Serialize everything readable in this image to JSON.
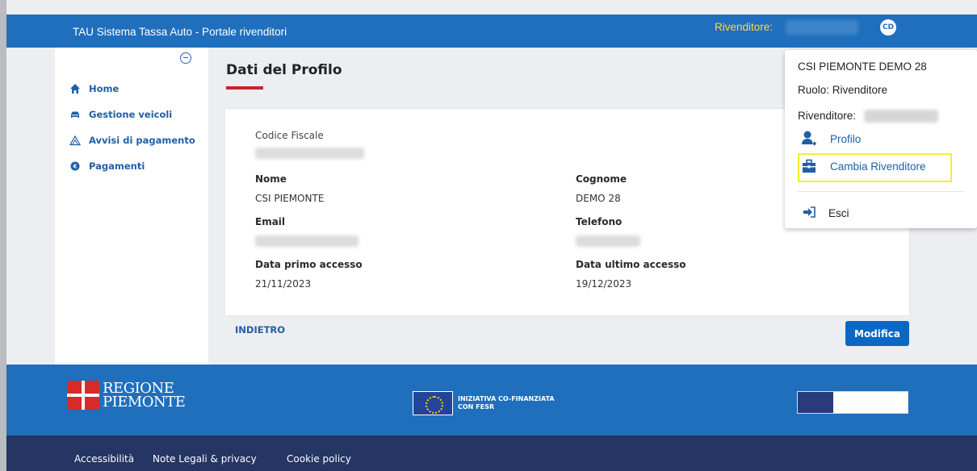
{
  "header": {
    "title": "TAU Sistema Tassa Auto - Portale rivenditori",
    "dealer_label": "Rivenditore:",
    "avatar_initials": "CD"
  },
  "sidebar": {
    "items": [
      {
        "label": "Home",
        "icon": "home-icon"
      },
      {
        "label": "Gestione veicoli",
        "icon": "car-icon"
      },
      {
        "label": "Avvisi di pagamento",
        "icon": "warning-icon"
      },
      {
        "label": "Pagamenti",
        "icon": "euro-icon"
      }
    ]
  },
  "main": {
    "page_title": "Dati del Profilo",
    "fields": {
      "codice_fiscale_label": "Codice Fiscale",
      "nome_label": "Nome",
      "nome_value": "CSI PIEMONTE",
      "cognome_label": "Cognome",
      "cognome_value": "DEMO 28",
      "email_label": "Email",
      "telefono_label": "Telefono",
      "primo_accesso_label": "Data primo accesso",
      "primo_accesso_value": "21/11/2023",
      "ultimo_accesso_label": "Data ultimo accesso",
      "ultimo_accesso_value": "19/12/2023"
    },
    "back_label": "INDIETRO",
    "edit_label": "Modifica"
  },
  "user_menu": {
    "user_name": "CSI PIEMONTE DEMO 28",
    "role": "Ruolo: Rivenditore",
    "dealer_label": "Rivenditore:",
    "profile_label": "Profilo",
    "change_dealer_label": "Cambia Rivenditore",
    "exit_label": "Esci"
  },
  "footer": {
    "regione_line1": "REGIONE",
    "regione_line2": "PIEMONTE",
    "eu_line1": "INIZIATIVA CO-FINANZIATA",
    "eu_line2": "CON FESR",
    "links": [
      "Accessibilità",
      "Note Legali & privacy",
      "Cookie policy"
    ]
  },
  "colors": {
    "header_blue": "#1f6fbd",
    "footer_navy": "#253564",
    "accent_red": "#c72626",
    "highlight_yellow": "#f2ef2a",
    "dealer_label_yellow": "#ffd93d"
  }
}
